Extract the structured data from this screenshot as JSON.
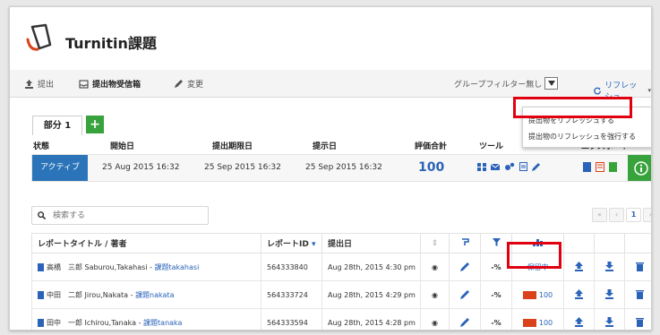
{
  "app": {
    "title": "Turnitin課題"
  },
  "nav": {
    "tab_submit": "提出",
    "tab_inbox": "提出物受信箱",
    "tab_edit": "変更",
    "filter_label": "グループフィルター無し",
    "refresh_label": "リフレッシュ"
  },
  "refresh_menu": {
    "item1": "提出物をリフレッシュする",
    "item2": "提出物のリフレッシュを強行する"
  },
  "section": {
    "tab_label": "部分 1",
    "add_label": "+"
  },
  "info": {
    "labels": {
      "state": "状態",
      "start": "開始日",
      "due": "提出期限日",
      "post": "提示日",
      "score": "評価合計",
      "tools": "ツール",
      "export": "エクスポート"
    },
    "state": "アクティブ",
    "start": "25 Aug 2015 16:32",
    "due": "25 Sep 2015 16:32",
    "post": "25 Sep 2015 16:32",
    "score": "100"
  },
  "search": {
    "placeholder": "検索する"
  },
  "pager": {
    "first": "«",
    "prev": "‹",
    "current": "1",
    "next": "›",
    "last": "»"
  },
  "table": {
    "headers": {
      "title": "レポートタイトル / 著者",
      "paper_id": "レポートID",
      "date": "提出日"
    },
    "rows": [
      {
        "author": "高橋　三郎 Saburou,Takahasi",
        "sep": "-",
        "assignment": "課題takahasi",
        "paper_id": "564333840",
        "date": "Aug 28th, 2015 4:30 pm",
        "pct": "-%",
        "similarity": "保留中",
        "sim_num": ""
      },
      {
        "author": "中田　二郎 Jirou,Nakata",
        "sep": "-",
        "assignment": "課題nakata",
        "paper_id": "564333724",
        "date": "Aug 28th, 2015 4:29 pm",
        "pct": "-%",
        "similarity": "",
        "sim_num": "100"
      },
      {
        "author": "田中　一郎 Ichirou,Tanaka",
        "sep": "-",
        "assignment": "課題tanaka",
        "paper_id": "564333594",
        "date": "Aug 28th, 2015 4:28 pm",
        "pct": "-%",
        "similarity": "",
        "sim_num": "100"
      }
    ]
  },
  "colors": {
    "accent_blue": "#2a63b8",
    "active_blue": "#2b74b9",
    "green": "#38a33c",
    "highlight_red": "#e10010",
    "sim_orange": "#d9421a"
  }
}
